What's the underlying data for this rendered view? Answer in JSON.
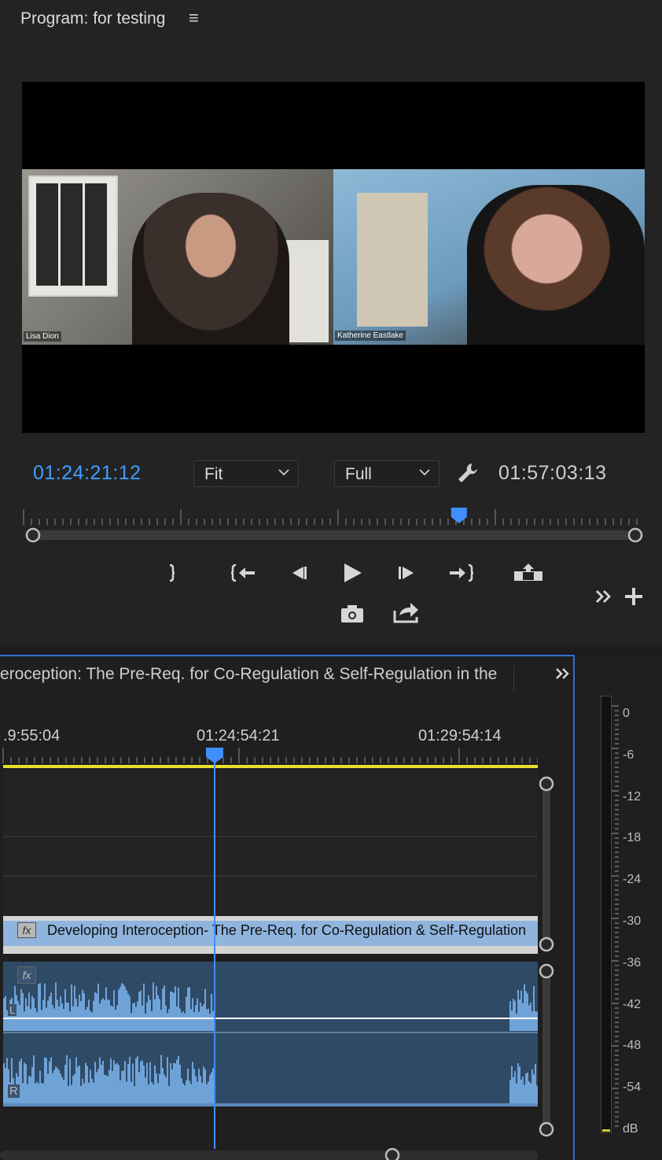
{
  "program_monitor": {
    "title": "Program: for testing",
    "menu_icon": "hamburger-menu-icon",
    "video": {
      "participant_left": "Lisa Dion",
      "participant_right": "Katherine Eastlake"
    },
    "current_timecode": "01:24:21:12",
    "zoom_value": "Fit",
    "quality_value": "Full",
    "duration_timecode": "01:57:03:13",
    "playhead_position": 0.71,
    "controls": [
      {
        "name": "mark-out-button",
        "icon": "mark-out-icon"
      },
      {
        "name": "go-to-in-button",
        "icon": "go-to-in-icon"
      },
      {
        "name": "step-back-button",
        "icon": "step-back-icon"
      },
      {
        "name": "play-button",
        "icon": "play-icon"
      },
      {
        "name": "step-forward-button",
        "icon": "step-forward-icon"
      },
      {
        "name": "go-to-out-button",
        "icon": "go-to-out-icon"
      },
      {
        "name": "lift-button",
        "icon": "lift-icon"
      },
      {
        "name": "export-frame-button",
        "icon": "camera-icon"
      },
      {
        "name": "insert-button",
        "icon": "insert-icon"
      },
      {
        "name": "more-controls-button",
        "icon": "double-chevron-right-icon"
      },
      {
        "name": "button-editor",
        "icon": "plus-icon"
      }
    ]
  },
  "timeline": {
    "sequence_name": "eroception: The Pre-Req. for Co-Regulation & Self-Regulation in the",
    "expand_icon": "double-chevron-right-icon",
    "ruler_times": [
      ".9:55:04",
      "01:24:54:21",
      "01:29:54:14"
    ],
    "video_clip": {
      "fx": "fx",
      "label": "Developing Interoception- The Pre-Req. for Co-Regulation & Self-Regulation"
    },
    "audio_clip": {
      "fx": "fx",
      "channel_left": "L",
      "channel_right": "R"
    }
  },
  "audio_meter": {
    "db_labels": [
      "0",
      "-6",
      "-12",
      "-18",
      "-24",
      "-30",
      "-36",
      "-42",
      "-48",
      "-54",
      "dB"
    ]
  },
  "colors": {
    "accent_blue": "#3f9fff",
    "in_out_yellow": "#e6e02a",
    "audio_clip": "#2f4a66",
    "video_clip": "#8fb4dd"
  }
}
